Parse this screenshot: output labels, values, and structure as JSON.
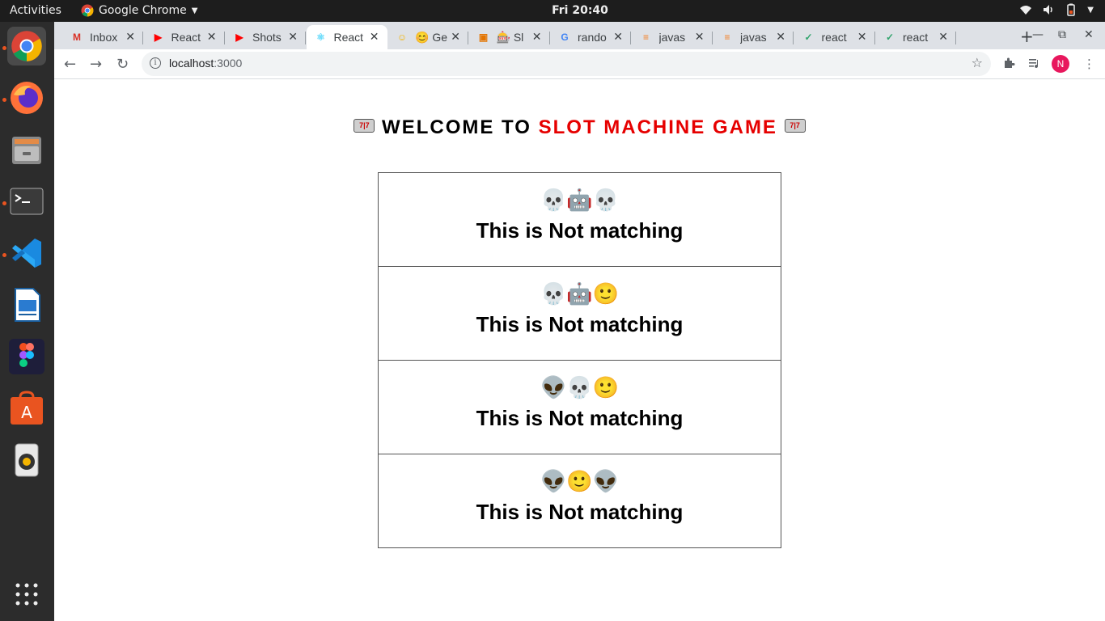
{
  "topbar": {
    "activities": "Activities",
    "app_name": "Google Chrome",
    "clock": "Fri 20:40"
  },
  "browser": {
    "tabs": [
      {
        "title": "Inbox",
        "icon": "gmail-icon"
      },
      {
        "title": "React",
        "icon": "youtube-icon"
      },
      {
        "title": "Shots",
        "icon": "youtube-icon"
      },
      {
        "title": "React",
        "icon": "react-icon",
        "active": true
      },
      {
        "title": "😊 Ge",
        "icon": "emoji-icon"
      },
      {
        "title": "🎰 Sl",
        "icon": "slot-icon"
      },
      {
        "title": "rando",
        "icon": "google-icon"
      },
      {
        "title": "javas",
        "icon": "stackoverflow-icon"
      },
      {
        "title": "javas",
        "icon": "stackoverflow-icon"
      },
      {
        "title": "react",
        "icon": "codesandbox-icon"
      },
      {
        "title": "react",
        "icon": "codesandbox-icon"
      }
    ],
    "url_host": "localhost",
    "url_port": ":3000",
    "profile_initial": "N"
  },
  "page": {
    "heading_prefix": "WELCOME TO",
    "heading_highlight": "SLOT MACHINE GAME",
    "accent_color": "#e60000",
    "results": [
      {
        "emojis": "💀🤖💀",
        "message": "This is Not matching"
      },
      {
        "emojis": "💀🤖🙂",
        "message": "This is Not matching"
      },
      {
        "emojis": "👽💀🙂",
        "message": "This is Not matching"
      },
      {
        "emojis": "👽🙂👽",
        "message": "This is Not matching"
      }
    ]
  }
}
